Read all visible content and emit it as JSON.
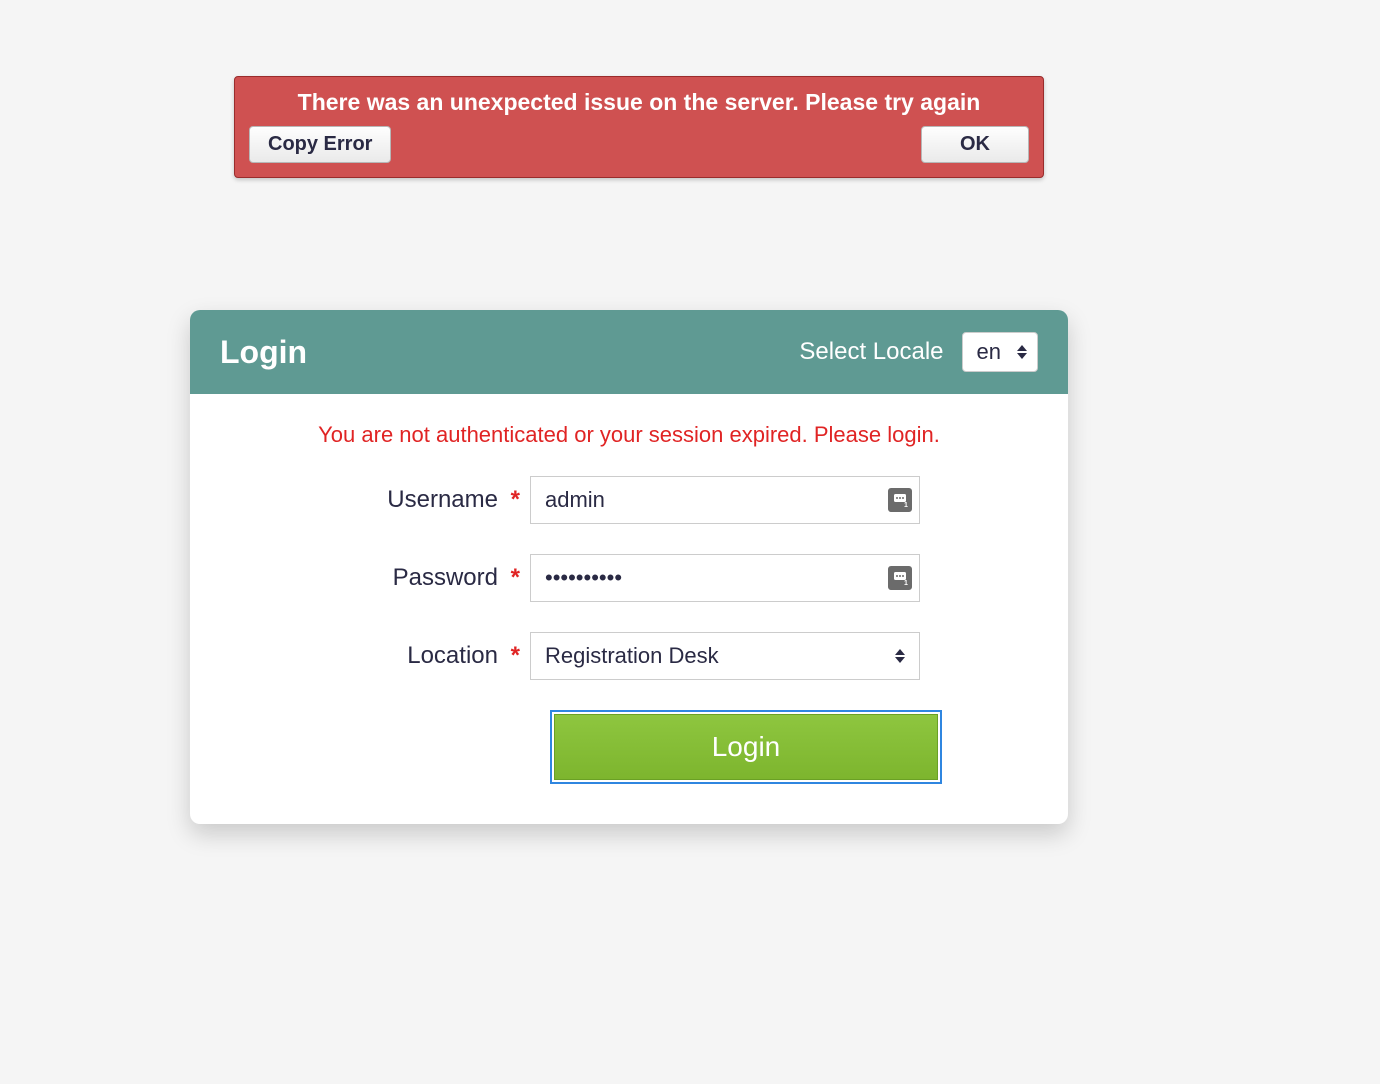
{
  "error": {
    "message": "There was an unexpected issue on the server. Please try again",
    "copy_label": "Copy Error",
    "ok_label": "OK"
  },
  "login": {
    "title": "Login",
    "locale_label": "Select Locale",
    "locale_value": "en",
    "warning": "You are not authenticated or your session expired. Please login.",
    "username_label": "Username",
    "username_value": "admin",
    "password_label": "Password",
    "password_value": "••••••••••",
    "location_label": "Location",
    "location_value": "Registration Desk",
    "submit_label": "Login"
  }
}
